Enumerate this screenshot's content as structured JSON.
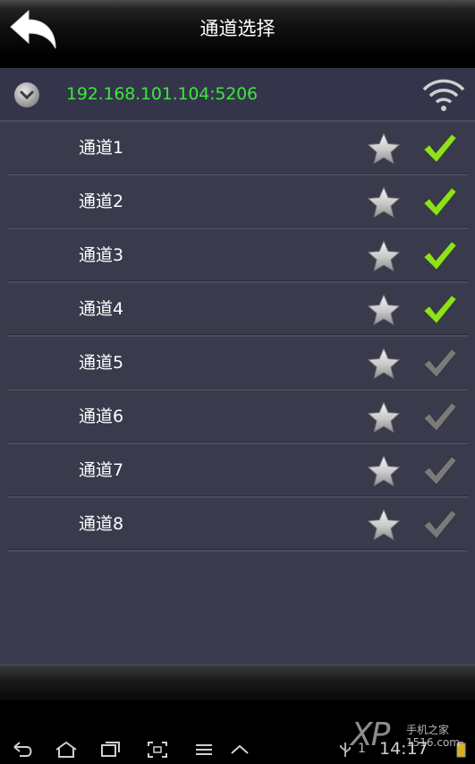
{
  "header": {
    "title": "通道选择",
    "back_icon": "back-arrow-icon"
  },
  "server": {
    "address": "192.168.101.104:5206",
    "expand_icon": "chevron-down-icon",
    "signal_icon": "wifi-icon",
    "address_color": "#3ee53e"
  },
  "channels": [
    {
      "label": "通道1",
      "selected": true
    },
    {
      "label": "通道2",
      "selected": true
    },
    {
      "label": "通道3",
      "selected": true
    },
    {
      "label": "通道4",
      "selected": true
    },
    {
      "label": "通道5",
      "selected": false
    },
    {
      "label": "通道6",
      "selected": false
    },
    {
      "label": "通道7",
      "selected": false
    },
    {
      "label": "通道8",
      "selected": false
    }
  ],
  "colors": {
    "check_active": "#8fe21a",
    "check_inactive": "#7a7a7a",
    "background": "#393a4b"
  },
  "status_bar": {
    "time": "14:17",
    "notification_count": "1"
  },
  "watermark": {
    "brand": "XP",
    "subtitle": "手机之家",
    "url": "1516.com"
  }
}
